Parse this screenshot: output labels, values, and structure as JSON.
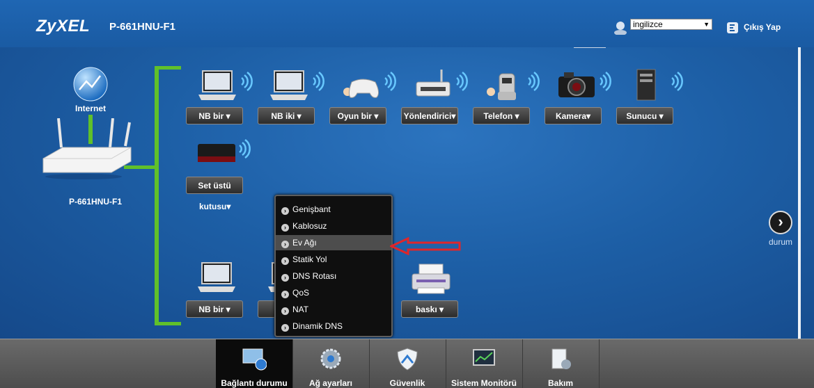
{
  "header": {
    "brand": "ZyXEL",
    "model": "P-661HNU-F1",
    "language_value": "ingilizce",
    "logout_label": "Çıkış Yap"
  },
  "network": {
    "internet_label": "Internet",
    "router_label": "P-661HNU-F1",
    "wireless_devices": [
      {
        "label": "NB bir",
        "icon": "laptop-icon"
      },
      {
        "label": "NB iki",
        "icon": "laptop-icon"
      },
      {
        "label": "Oyun bir",
        "icon": "gamepad-icon"
      },
      {
        "label": "Yönlendirici",
        "icon": "router-icon"
      },
      {
        "label": "Telefon",
        "icon": "phone-icon"
      },
      {
        "label": "Kamera",
        "icon": "camera-icon"
      },
      {
        "label": "Sunucu",
        "icon": "server-icon"
      }
    ],
    "settop": {
      "label": "Set üstü",
      "label2": "kutusu"
    },
    "wired_devices": [
      {
        "label": "NB bir",
        "icon": "laptop-icon"
      },
      {
        "label": "baskı",
        "icon": "printer-icon"
      }
    ]
  },
  "menu": {
    "items": [
      "Genişbant",
      "Kablosuz",
      "Ev Ağı",
      "Statik Yol",
      "DNS Rotası",
      "QoS",
      "NAT",
      "Dinamik DNS"
    ],
    "active_index": 2
  },
  "next": {
    "label": "durum"
  },
  "tabs": [
    {
      "label": "Bağlantı durumu",
      "icon": "connection-status-icon",
      "active": true
    },
    {
      "label": "Ağ ayarları",
      "icon": "gear-icon",
      "active": false
    },
    {
      "label": "Güvenlik",
      "icon": "shield-icon",
      "active": false
    },
    {
      "label": "Sistem Monitörü",
      "icon": "monitor-chart-icon",
      "active": false
    },
    {
      "label": "Bakım",
      "icon": "maintenance-icon",
      "active": false
    }
  ],
  "colors": {
    "link_line": "#60c02a",
    "arrow": "#e0262a",
    "background": "#1d5fa6"
  }
}
